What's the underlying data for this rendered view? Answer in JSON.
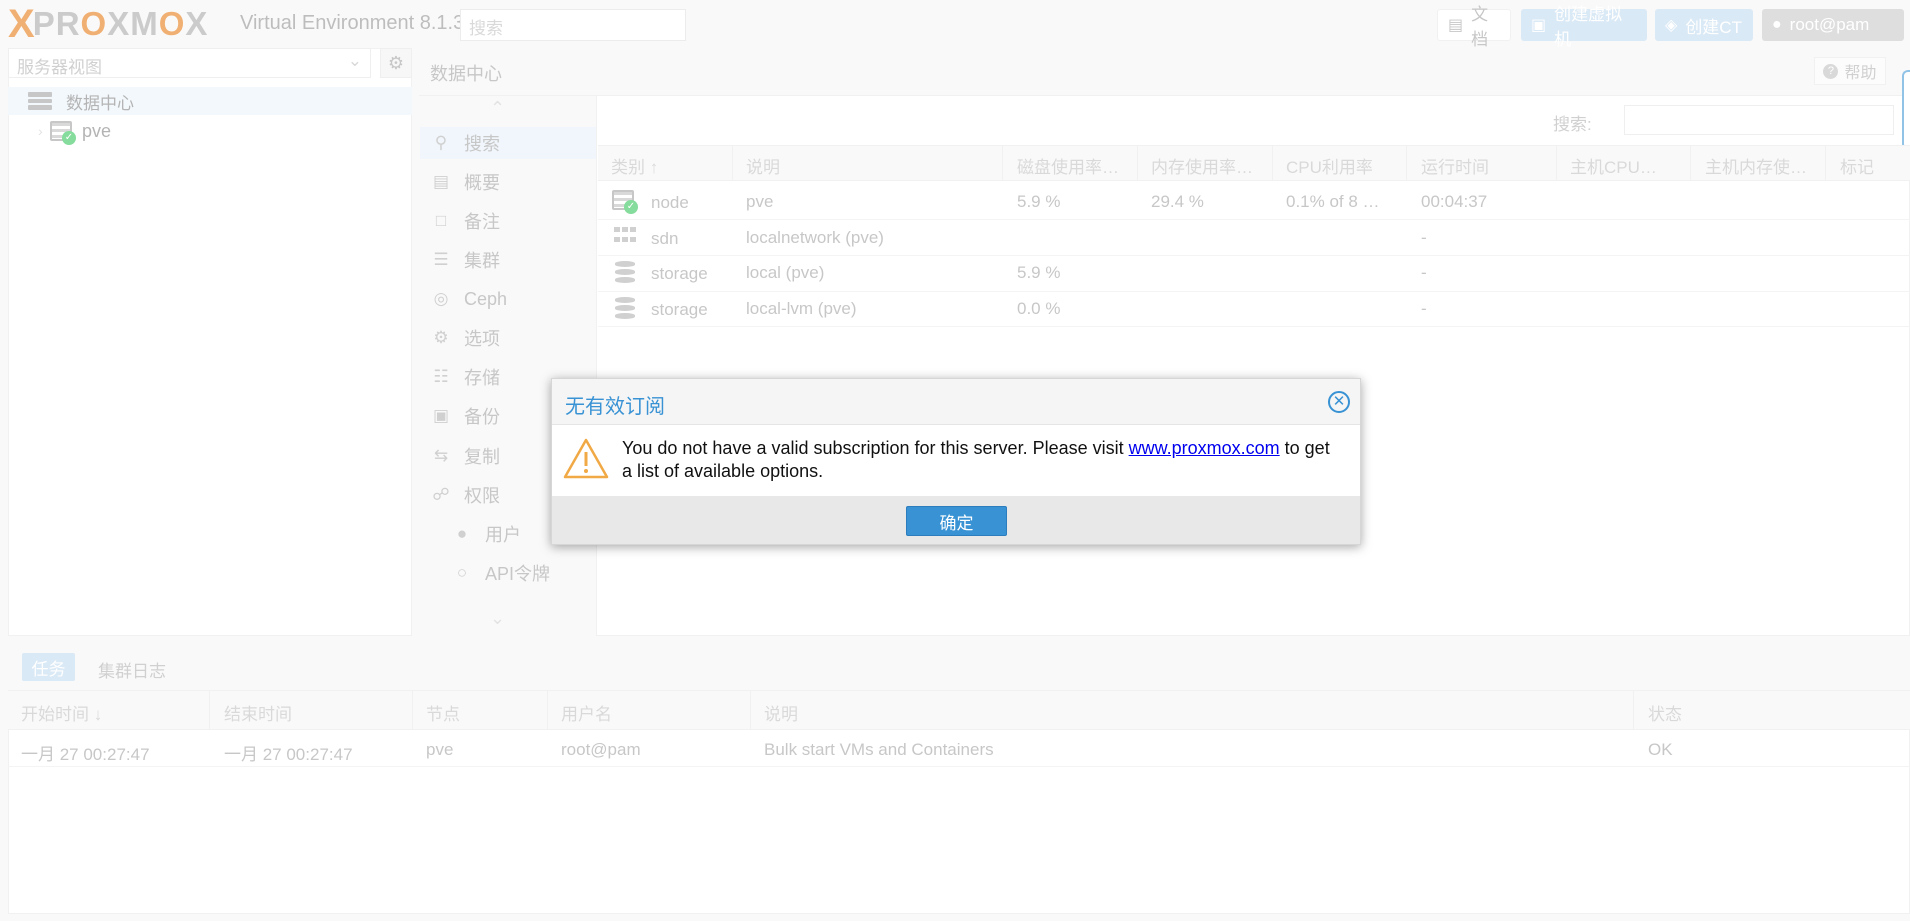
{
  "header": {
    "logo_text": "PROXMOX",
    "version": "Virtual Environment 8.1.3",
    "search_placeholder": "搜索",
    "docs_label": "文档",
    "create_vm_label": "创建虚拟机",
    "create_ct_label": "创建CT",
    "user_label": "root@pam"
  },
  "tree": {
    "view_select": "服务器视图",
    "datacenter": "数据中心",
    "node": "pve"
  },
  "main": {
    "title": "数据中心",
    "help_label": "帮助",
    "nav": [
      {
        "label": "搜索",
        "icon": "search-icon"
      },
      {
        "label": "概要",
        "icon": "book-icon"
      },
      {
        "label": "备注",
        "icon": "note-icon"
      },
      {
        "label": "集群",
        "icon": "server-icon"
      },
      {
        "label": "Ceph",
        "icon": "ceph-icon"
      },
      {
        "label": "选项",
        "icon": "gear-icon"
      },
      {
        "label": "存储",
        "icon": "database-icon"
      },
      {
        "label": "备份",
        "icon": "floppy-icon"
      },
      {
        "label": "复制",
        "icon": "retweet-icon"
      },
      {
        "label": "权限",
        "icon": "unlock-icon"
      },
      {
        "label": "用户",
        "icon": "user-icon"
      },
      {
        "label": "API令牌",
        "icon": "user-outline-icon"
      }
    ],
    "search_label": "搜索:",
    "columns": [
      "类别 ↑",
      "说明",
      "磁盘使用率…",
      "内存使用率…",
      "CPU利用率",
      "运行时间",
      "主机CPU…",
      "主机内存使…",
      "标记"
    ],
    "rows": [
      {
        "type": "node",
        "desc": "pve",
        "disk": "5.9 %",
        "mem": "29.4 %",
        "cpu": "0.1% of 8 …",
        "uptime": "00:04:37"
      },
      {
        "type": "sdn",
        "desc": "localnetwork (pve)",
        "disk": "",
        "mem": "",
        "cpu": "",
        "uptime": "-"
      },
      {
        "type": "storage",
        "desc": "local (pve)",
        "disk": "5.9 %",
        "mem": "",
        "cpu": "",
        "uptime": "-"
      },
      {
        "type": "storage",
        "desc": "local-lvm (pve)",
        "disk": "0.0 %",
        "mem": "",
        "cpu": "",
        "uptime": "-"
      }
    ]
  },
  "log": {
    "tab_tasks": "任务",
    "tab_cluster": "集群日志",
    "columns": [
      "开始时间 ↓",
      "结束时间",
      "节点",
      "用户名",
      "说明",
      "状态"
    ],
    "row": {
      "start": "一月 27 00:27:47",
      "end": "一月 27 00:27:47",
      "node": "pve",
      "user": "root@pam",
      "desc": "Bulk start VMs and Containers",
      "status": "OK"
    }
  },
  "dialog": {
    "title": "无有效订阅",
    "message_before": "You do not have a valid subscription for this server. Please visit ",
    "link": "www.proxmox.com",
    "message_after": " to get a list of available options.",
    "ok_label": "确定"
  },
  "colors": {
    "accent": "#3892d4",
    "brand": "#e57000",
    "ok": "#21bf4b"
  }
}
